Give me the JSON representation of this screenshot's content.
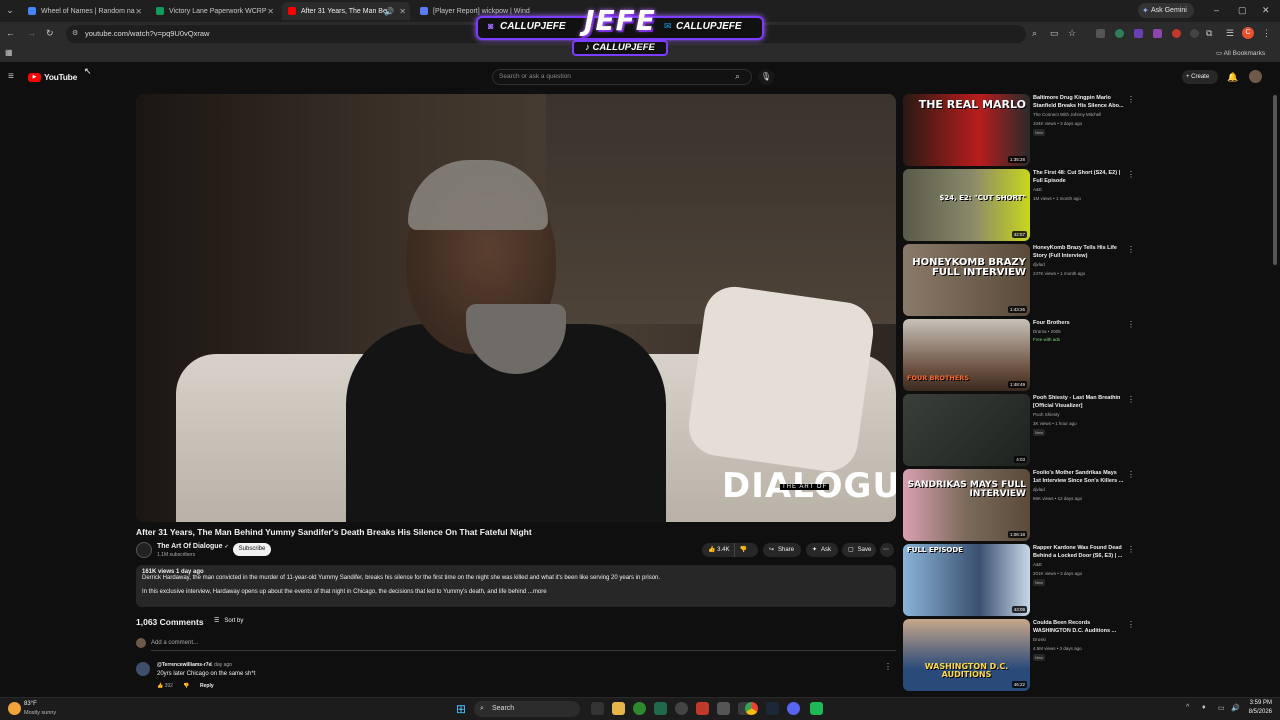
{
  "browser": {
    "tabs": [
      {
        "title": "Wheel of Names | Random na",
        "color": "#4285f4"
      },
      {
        "title": "Victory Lane Paperwork WCRP",
        "color": "#0f9d58"
      },
      {
        "title": "After 31 Years, The Man Be",
        "color": "#ff0000"
      },
      {
        "title": "[Player Report] wickpow | Wind",
        "color": "#5b7cfa"
      }
    ],
    "url": "youtube.com/watch?v=pq9U0vQxraw",
    "ask_gemini": "Ask Gemini",
    "all_bookmarks": "All Bookmarks",
    "profile_initial": "C"
  },
  "overlay": {
    "big": "JEFE",
    "left_handle": "CALLUPJEFE",
    "right_handle": "CALLUPJEFE",
    "bottom_handle": "CALLUPJEFE"
  },
  "youtube": {
    "logo": "YouTube",
    "search_placeholder": "Search or ask a question",
    "create": "Create"
  },
  "video": {
    "watermark_big": "DIALOGUE",
    "watermark_small": "THE ART OF",
    "title": "After 31 Years, The Man Behind Yummy Sandifer's Death Breaks His Silence On That Fateful Night",
    "channel": "The Art Of Dialogue",
    "subscribers": "1.1M subscribers",
    "subscribe": "Subscribe",
    "likes": "3.4K",
    "share": "Share",
    "ask": "Ask",
    "save": "Save",
    "desc_meta": "161K views  1 day ago",
    "desc_line1": "Derrick Hardaway, the man convicted in the murder of 11-year-old Yummy Sandifer, breaks his silence for the first time on the night she was killed and what it's been like serving 20 years in prison.",
    "desc_line2": "In this exclusive interview, Hardaway opens up about the events of that night in Chicago, the decisions that led to Yummy's death, and life behind ...more"
  },
  "comments": {
    "count": "1,063 Comments",
    "sort": "Sort by",
    "add": "Add a comment...",
    "first": {
      "author": "@Terrencewilliams-r7e",
      "time": "1 day ago",
      "text": "20yrs later Chicago on the same sh*t",
      "likes": "392",
      "reply": "Reply"
    }
  },
  "recommendations": [
    {
      "title": "Baltimore Drug Kingpin Marlo Stanfield Breaks His Silence Abo...",
      "channel": "The Connect With Johnny Mitchell",
      "meta": "104K views • 3 days ago",
      "badge": "New",
      "duration": "1:35:28",
      "caption": "THE REAL MARLO",
      "bg": "#7a1010"
    },
    {
      "title": "The First 48: Cut Short (S24, E2) | Full Episode",
      "channel": "A&E",
      "meta": "1M views • 1 month ago",
      "badge": "",
      "duration": "42:57",
      "caption": "$24, E2: \"CUT SHORT\"",
      "bg": "#4a4a3a"
    },
    {
      "title": "HoneyKomb Brazy Tells His Life Story (Full Interview)",
      "channel": "djvlad",
      "meta": "247K views • 1 month ago",
      "badge": "",
      "duration": "1:43:26",
      "caption": "HONEYKOMB BRAZY FULL INTERVIEW",
      "bg": "#5a4a3a"
    },
    {
      "title": "Four Brothers",
      "channel": "Drama • 2005",
      "meta": "Free with ads",
      "badge": "",
      "duration": "1:48:49",
      "caption": "FOUR BROTHERS",
      "bg": "#6a5040"
    },
    {
      "title": "Pooh Shiesty - Last Man Breathin [Official Visualizer]",
      "channel": "Pooh Shiesty",
      "meta": "3K views • 1 hour ago",
      "badge": "New",
      "duration": "4:03",
      "caption": "",
      "bg": "#2a2f2a"
    },
    {
      "title": "Foolio's Mother Sandrikas Mays 1st Interview Since Son's Killers ...",
      "channel": "djvlad",
      "meta": "66K views • 12 days ago",
      "badge": "",
      "duration": "1:06:18",
      "caption": "SANDRIKAS MAYS FULL INTERVIEW",
      "bg": "#6a6058"
    },
    {
      "title": "Rapper Kardone Was Found Dead Behind a Locked Door (S6, E3) | ...",
      "channel": "A&E",
      "meta": "201K views • 3 days ago",
      "badge": "New",
      "duration": "43:09",
      "caption": "FULL EPISODE",
      "bg": "#3a5070"
    },
    {
      "title": "Coulda Been Records WASHINGTON D.C. Auditions ...",
      "channel": "Druski",
      "meta": "4.5M views • 3 days ago",
      "badge": "New",
      "duration": "46:22",
      "caption": "WASHINGTON D.C. AUDITIONS",
      "bg": "#2a4a7a"
    }
  ],
  "taskbar": {
    "weather_temp": "83°F",
    "weather_desc": "Mostly sunny",
    "search": "Search",
    "time": "3:59 PM",
    "date": "8/5/2026"
  }
}
